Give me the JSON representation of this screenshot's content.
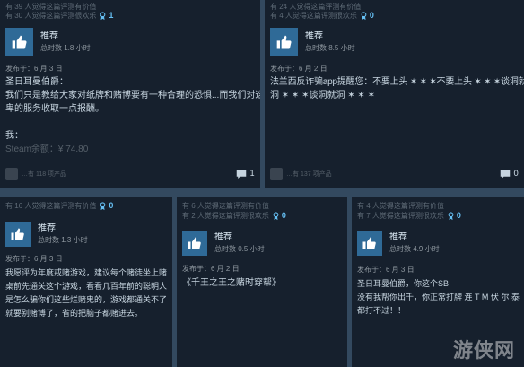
{
  "colors": {
    "accent": "#66c0f4",
    "thumb_bg": "#2f6a97",
    "card_bg": "#16202d",
    "page_bg": "#33495f"
  },
  "icons": {
    "recommend": "thumbs-up-icon",
    "award": "award-icon",
    "comment": "comment-icon"
  },
  "reviews": [
    {
      "helpful": "有 39 人觉得这篇评测有价值",
      "funny": "有 30 人觉得这篇评测很欢乐",
      "awards": "1",
      "recommendation": "推荐",
      "hours": "总时数 1.8 小时",
      "posted": "发布于：6 月 3 日",
      "lines": [
        "圣日耳曼伯爵：",
        "我们只是教给大家对纸牌和赌博要有一种合理的恐惧...而我们对这种谦",
        "卑的服务收取一点报酬。",
        "",
        "我：",
        "Steam余额：¥ 74.80"
      ],
      "footer_meta": "…有 118 项产品",
      "comment_count": "1"
    },
    {
      "helpful": "有 24 人觉得这篇评测有价值",
      "funny": "有 4 人觉得这篇评测很欢乐",
      "awards": "0",
      "recommendation": "推荐",
      "hours": "总时数 8.5 小时",
      "posted": "发布于：6 月 2 日",
      "lines": [
        "法兰西反诈骗app提醒您：不要上头 ✶ ✶ ✶不要上头 ✶ ✶ ✶谈洞就",
        "洞 ✶ ✶ ✶谈洞就洞 ✶ ✶ ✶"
      ],
      "footer_meta": "…有 137 项产品",
      "comment_count": "0"
    },
    {
      "helpful": "有 16 人觉得这篇评测有价值",
      "awards": "0",
      "recommendation": "推荐",
      "hours": "总时数 1.3 小时",
      "posted": "发布于：6 月 3 日",
      "lines": [
        "我愿评为年度戒赌游戏，建议每个赌徒坐上赌",
        "桌前先通关这个游戏，看看几百年前的聪明人",
        "是怎么骗你们这些烂赌鬼的，游戏都通关不了",
        "就要别赌博了，省的把脑子都赌进去。"
      ]
    },
    {
      "helpful": "有 6 人觉得这篇评测有价值",
      "funny": "有 2 人觉得这篇评测很欢乐",
      "awards": "0",
      "recommendation": "推荐",
      "hours": "总时数 0.5 小时",
      "posted": "发布于：6 月 2 日",
      "lines": [
        "《千王之王之赌时穿帮》"
      ]
    },
    {
      "helpful": "有 4 人觉得这篇评测有价值",
      "funny": "有 7 人觉得这篇评测很欢乐",
      "awards": "0",
      "recommendation": "推荐",
      "hours": "总时数 4.9 小时",
      "posted": "发布于：6 月 3 日",
      "lines": [
        "圣日耳曼伯爵，你这个SB",
        "没有我帮你出千，你正常打牌 连 T M 伏 尔 泰",
        "都打不过！！"
      ]
    }
  ],
  "watermark": "游侠网"
}
